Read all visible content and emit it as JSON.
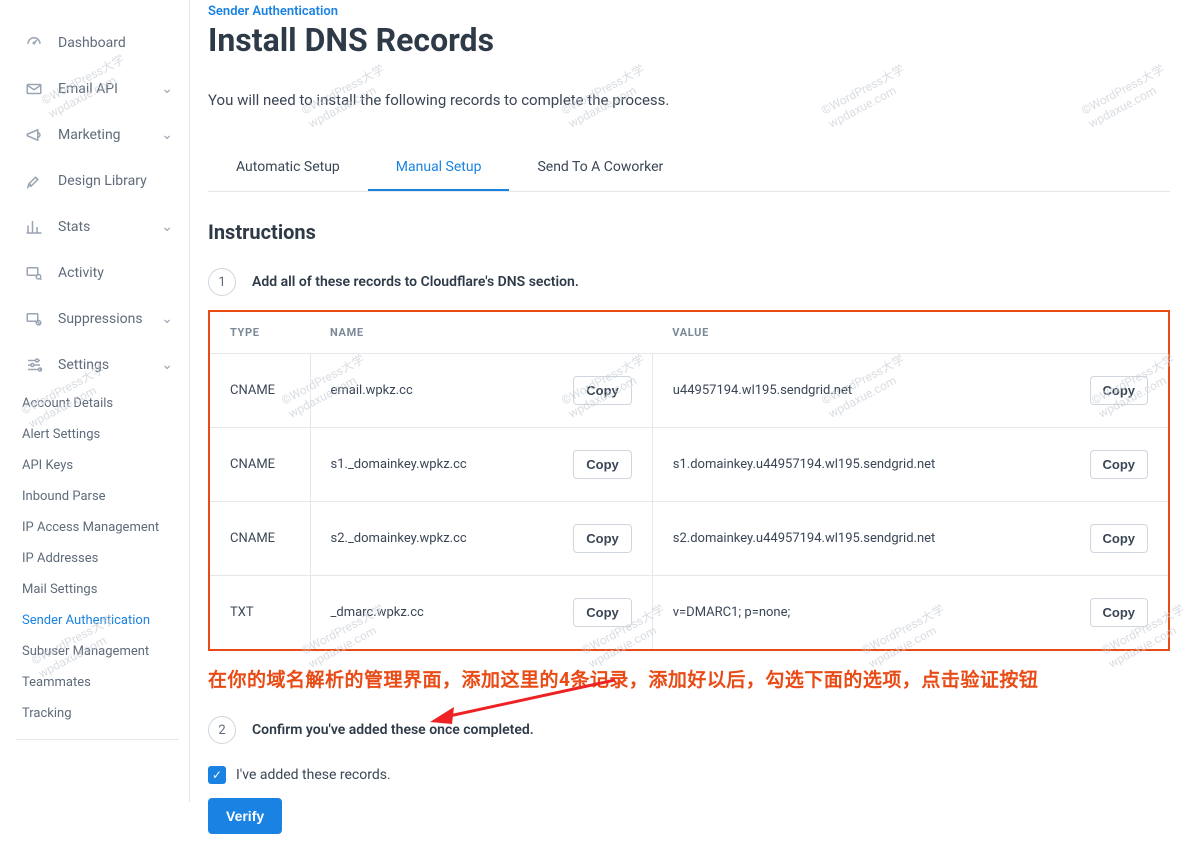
{
  "sidebar": {
    "items": [
      {
        "label": "Dashboard",
        "expandable": false
      },
      {
        "label": "Email API",
        "expandable": true
      },
      {
        "label": "Marketing",
        "expandable": true
      },
      {
        "label": "Design Library",
        "expandable": false
      },
      {
        "label": "Stats",
        "expandable": true
      },
      {
        "label": "Activity",
        "expandable": false
      },
      {
        "label": "Suppressions",
        "expandable": true
      },
      {
        "label": "Settings",
        "expandable": true
      }
    ],
    "subitems": [
      "Account Details",
      "Alert Settings",
      "API Keys",
      "Inbound Parse",
      "IP Access Management",
      "IP Addresses",
      "Mail Settings",
      "Sender Authentication",
      "Subuser Management",
      "Teammates",
      "Tracking"
    ],
    "active_sub": "Sender Authentication"
  },
  "breadcrumb": "Sender Authentication",
  "title": "Install DNS Records",
  "intro": "You will need to install the following records to complete the process.",
  "tabs": [
    "Automatic Setup",
    "Manual Setup",
    "Send To A Coworker"
  ],
  "active_tab": "Manual Setup",
  "instructions_heading": "Instructions",
  "step1": {
    "num": "1",
    "text": "Add all of these records to Cloudflare's DNS section."
  },
  "table": {
    "headers": [
      "TYPE",
      "NAME",
      "VALUE"
    ],
    "rows": [
      {
        "type": "CNAME",
        "name": "email.wpkz.cc",
        "value": "u44957194.wl195.sendgrid.net"
      },
      {
        "type": "CNAME",
        "name": "s1._domainkey.wpkz.cc",
        "value": "s1.domainkey.u44957194.wl195.sendgrid.net"
      },
      {
        "type": "CNAME",
        "name": "s2._domainkey.wpkz.cc",
        "value": "s2.domainkey.u44957194.wl195.sendgrid.net"
      },
      {
        "type": "TXT",
        "name": "_dmarc.wpkz.cc",
        "value": "v=DMARC1; p=none;"
      }
    ],
    "copy_label": "Copy"
  },
  "annotation": "在你的域名解析的管理界面，添加这里的4条记录，添加好以后，勾选下面的选项，点击验证按钮",
  "step2": {
    "num": "2",
    "text": "Confirm you've added these once completed."
  },
  "checkbox": {
    "label": "I've added these records.",
    "checked": true
  },
  "verify_label": "Verify",
  "watermark": {
    "line1": "©WordPress大学",
    "line2": "wpdaxue.com"
  }
}
